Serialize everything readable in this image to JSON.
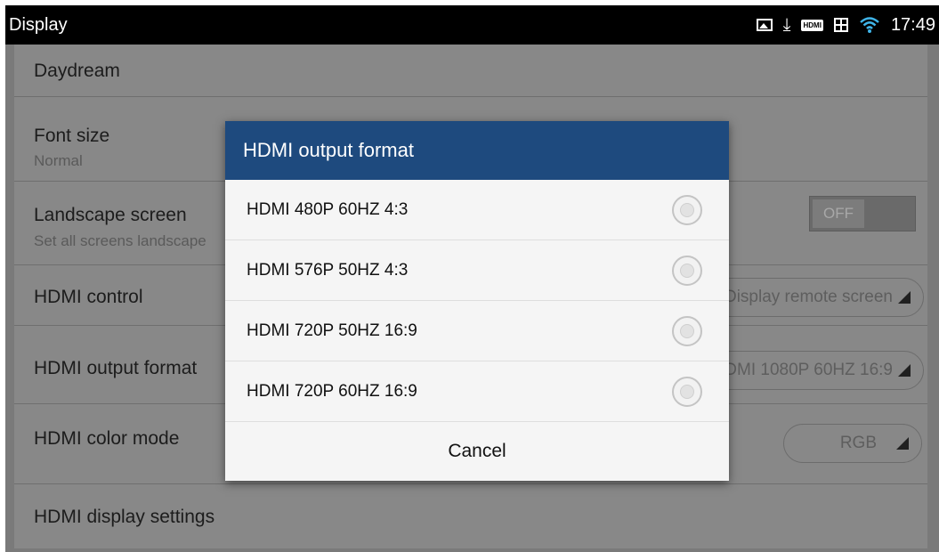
{
  "statusbar": {
    "title": "Display",
    "time": "17:49",
    "icons": [
      "image-icon",
      "download-icon",
      "hdmi-icon",
      "sim-card-icon",
      "wifi-icon"
    ],
    "hdmi_badge": "HDMI"
  },
  "settings": {
    "daydream": "Daydream",
    "font_size": "Font size",
    "font_size_value": "Normal",
    "landscape": "Landscape screen",
    "landscape_sub": "Set all screens landscape",
    "landscape_toggle": "OFF",
    "hdmi_control": "HDMI control",
    "hdmi_control_value": "Display remote screen",
    "hdmi_output": "HDMI output format",
    "hdmi_output_value": "HDMI 1080P 60HZ 16:9",
    "hdmi_color": "HDMI color mode",
    "hdmi_color_value": "RGB",
    "hdmi_display": "HDMI display settings"
  },
  "dialog": {
    "title": "HDMI output format",
    "options": [
      "HDMI 480P 60HZ 4:3",
      "HDMI 576P 50HZ 4:3",
      "HDMI 720P 50HZ 16:9",
      "HDMI 720P 60HZ 16:9"
    ],
    "cancel": "Cancel"
  },
  "colors": {
    "dialog_header": "#1e4a7e",
    "statusbar": "#000000",
    "dim_background": "#888888"
  }
}
